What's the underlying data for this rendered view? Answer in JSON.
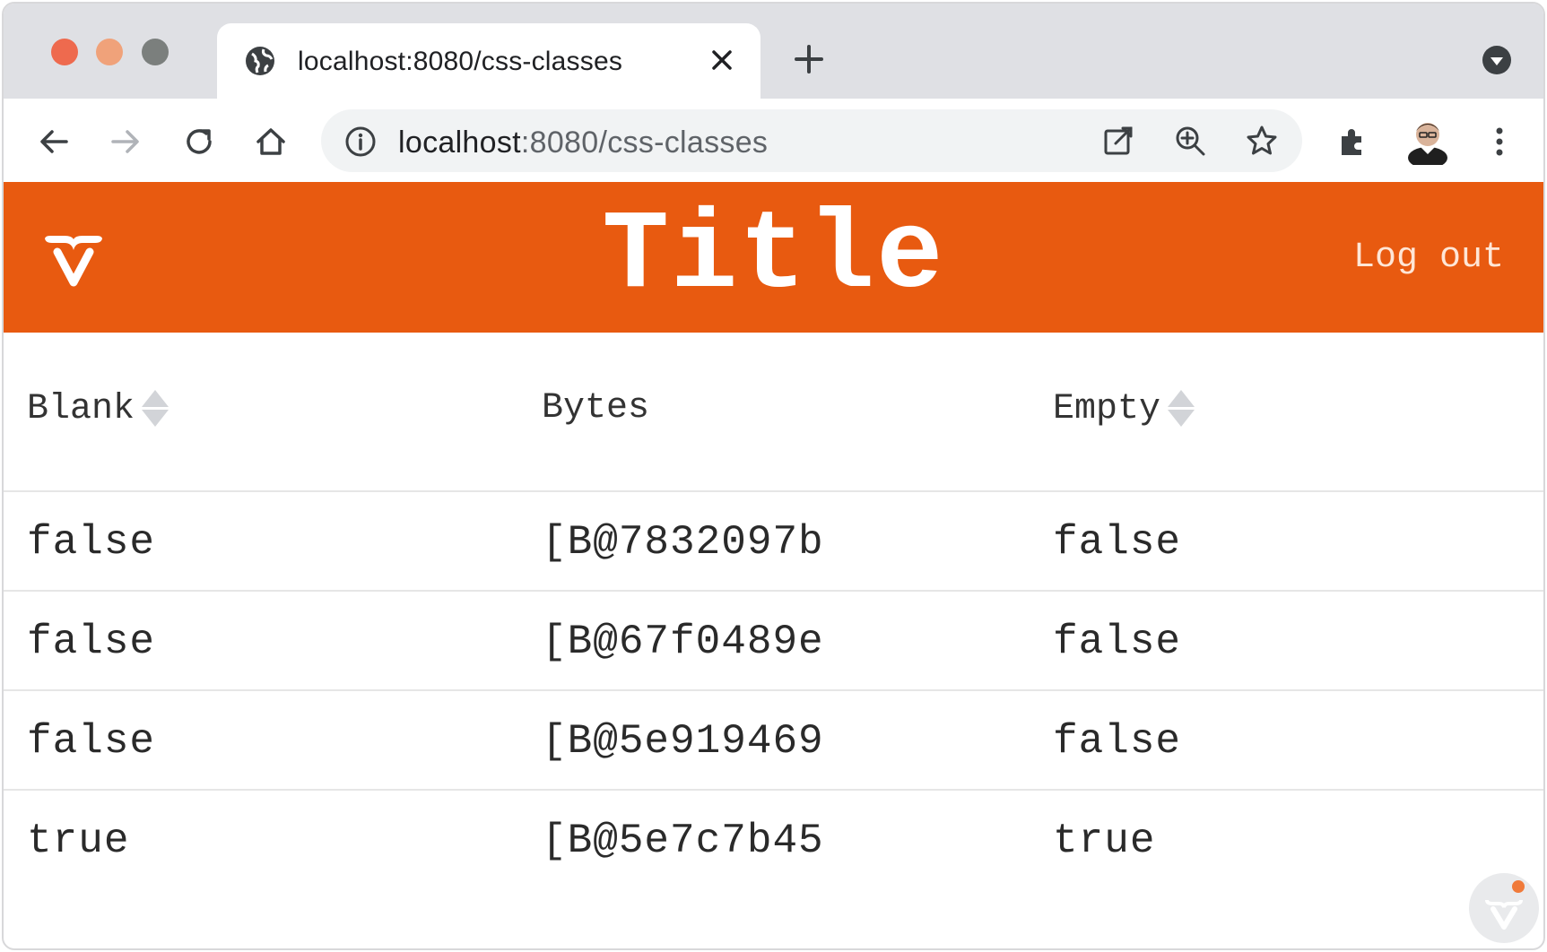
{
  "browser": {
    "tab_title": "localhost:8080/css-classes",
    "url_host": "localhost",
    "url_path": ":8080/css-classes",
    "window_controls": [
      "close",
      "minimize",
      "zoom"
    ],
    "toolbar_icons": [
      "back-arrow-icon",
      "forward-arrow-icon",
      "reload-icon",
      "home-icon"
    ],
    "omnibox_icons": [
      "open-in-new-icon",
      "zoom-icon",
      "star-icon"
    ],
    "right_icons": [
      "extensions-icon",
      "profile-avatar",
      "more-menu-icon"
    ]
  },
  "header": {
    "title": "Title",
    "logout_label": "Log out",
    "brand_color": "#e85a10",
    "logo": "vaadin-logo"
  },
  "grid": {
    "columns": [
      {
        "label": "Blank",
        "sortable": true
      },
      {
        "label": "Bytes",
        "sortable": false
      },
      {
        "label": "Empty",
        "sortable": true
      }
    ],
    "rows": [
      {
        "blank": "false",
        "bytes": "[B@7832097b",
        "empty": "false"
      },
      {
        "blank": "false",
        "bytes": "[B@67f0489e",
        "empty": "false"
      },
      {
        "blank": "false",
        "bytes": "[B@5e919469",
        "empty": "false"
      },
      {
        "blank": "true",
        "bytes": "[B@5e7c7b45",
        "empty": "true"
      }
    ]
  },
  "dev_tools": {
    "icon": "vaadin-devtools-icon"
  }
}
